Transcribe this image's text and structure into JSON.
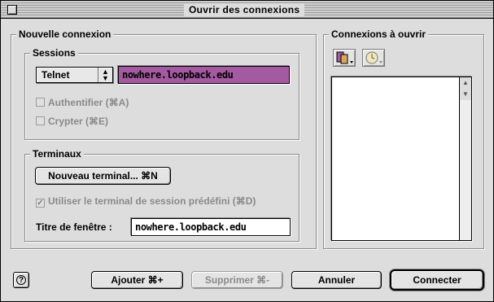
{
  "window": {
    "title": "Ouvrir des connexions"
  },
  "new_connection": {
    "group_label": "Nouvelle connexion",
    "sessions": {
      "group_label": "Sessions",
      "protocol_selected": "Telnet",
      "host_value": "nowhere.loopback.edu",
      "auth_label": "Authentifier (⌘A)",
      "encrypt_label": "Crypter (⌘E)"
    },
    "terminals": {
      "group_label": "Terminaux",
      "new_terminal_label": "Nouveau terminal... ⌘N",
      "use_default_label": "Utiliser le terminal de session prédéfini (⌘D)",
      "window_title_label": "Titre de fenêtre :",
      "window_title_value": "nowhere.loopback.edu"
    }
  },
  "connections_to_open": {
    "group_label": "Connexions à ouvrir"
  },
  "buttons": {
    "add": "Ajouter ⌘+",
    "remove": "Supprimer ⌘-",
    "cancel": "Annuler",
    "connect": "Connecter"
  },
  "colors": {
    "selection": "#a45aa0",
    "window_bg": "#dddddd"
  }
}
